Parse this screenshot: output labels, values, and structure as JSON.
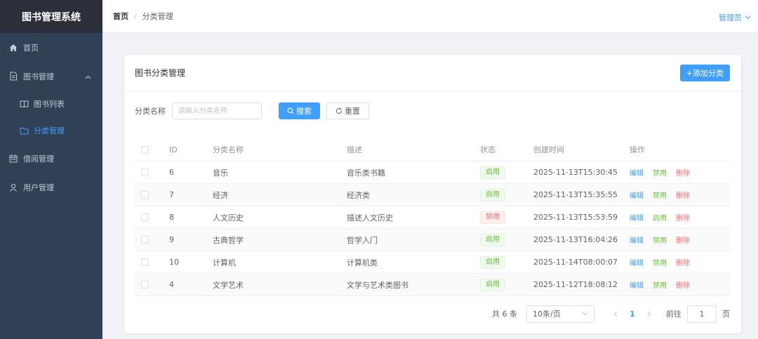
{
  "app": {
    "title": "图书管理系统"
  },
  "sidebar": {
    "home": "首页",
    "book_mgmt": "图书管理",
    "book_list": "图书列表",
    "category_mgmt": "分类管理",
    "borrow_mgmt": "借阅管理",
    "user_mgmt": "用户管理"
  },
  "header": {
    "crumb_home": "首页",
    "crumb_sep": "/",
    "crumb_current": "分类管理",
    "user": "管理员"
  },
  "card": {
    "title": "图书分类管理",
    "add_button": "+添加分类"
  },
  "search": {
    "label": "分类名称",
    "placeholder": "请输入分类名称",
    "search_button": "搜索",
    "reset_button": "重置"
  },
  "table": {
    "columns": [
      "ID",
      "分类名称",
      "描述",
      "状态",
      "创建时间",
      "操作"
    ],
    "rows": [
      {
        "id": "6",
        "name": "音乐",
        "desc": "音乐类书籍",
        "status": "启用",
        "time": "2025-11-13T15:30:45",
        "toggle": "禁用"
      },
      {
        "id": "7",
        "name": "经济",
        "desc": "经济类",
        "status": "启用",
        "time": "2025-11-13T15:35:55",
        "toggle": "禁用"
      },
      {
        "id": "8",
        "name": "人文历史",
        "desc": "描述人文历史",
        "status": "禁用",
        "time": "2025-11-13T15:53:59",
        "toggle": "启用"
      },
      {
        "id": "9",
        "name": "古典哲学",
        "desc": "哲学入门",
        "status": "启用",
        "time": "2025-11-13T16:04:26",
        "toggle": "禁用"
      },
      {
        "id": "10",
        "name": "计算机",
        "desc": "计算机类",
        "status": "启用",
        "time": "2025-11-14T08:00:07",
        "toggle": "禁用"
      },
      {
        "id": "4",
        "name": "文学艺术",
        "desc": "文学与艺术类图书",
        "status": "启用",
        "time": "2025-11-12T18:08:12",
        "toggle": "禁用"
      }
    ],
    "edit_label": "编辑",
    "delete_label": "删除"
  },
  "pagination": {
    "total": "共 6 条",
    "page_size": "10条/页",
    "current_page": "1",
    "goto_label": "前往",
    "goto_value": "1",
    "page_suffix": "页"
  },
  "colors": {
    "sidebar_bg": "#304156",
    "brand_bg": "#2b2f3a",
    "primary": "#409eff",
    "success": "#67c23a",
    "danger": "#f56c6c"
  }
}
